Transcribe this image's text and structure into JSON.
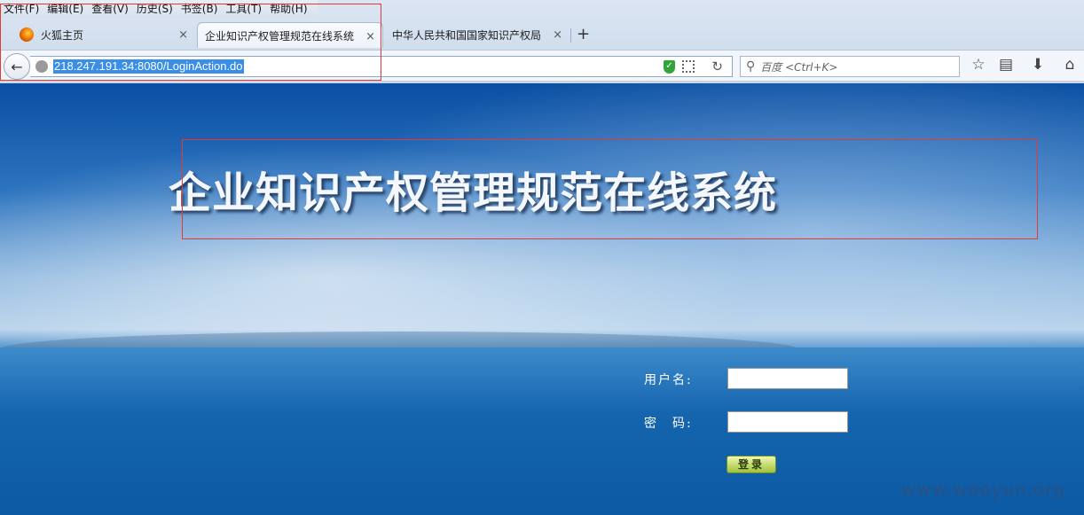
{
  "menubar": {
    "items": [
      "文件(F)",
      "编辑(E)",
      "查看(V)",
      "历史(S)",
      "书签(B)",
      "工具(T)",
      "帮助(H)"
    ]
  },
  "tabs": {
    "home_label": "火狐主页",
    "active_label": "企业知识产权管理规范在线系统",
    "other_label": "中华人民共和国国家知识产权局",
    "close_glyph": "×",
    "new_tab_glyph": "+"
  },
  "navbar": {
    "url": "218.247.191.34:8080/LoginAction.do",
    "search_placeholder": "百度 <Ctrl+K>"
  },
  "page": {
    "title": "企业知识产权管理规范在线系统",
    "username_label": "用户名:",
    "password_label": "密　码:",
    "username_value": "",
    "password_value": "",
    "login_label": "登录",
    "watermark": "www.wooyun.org"
  }
}
